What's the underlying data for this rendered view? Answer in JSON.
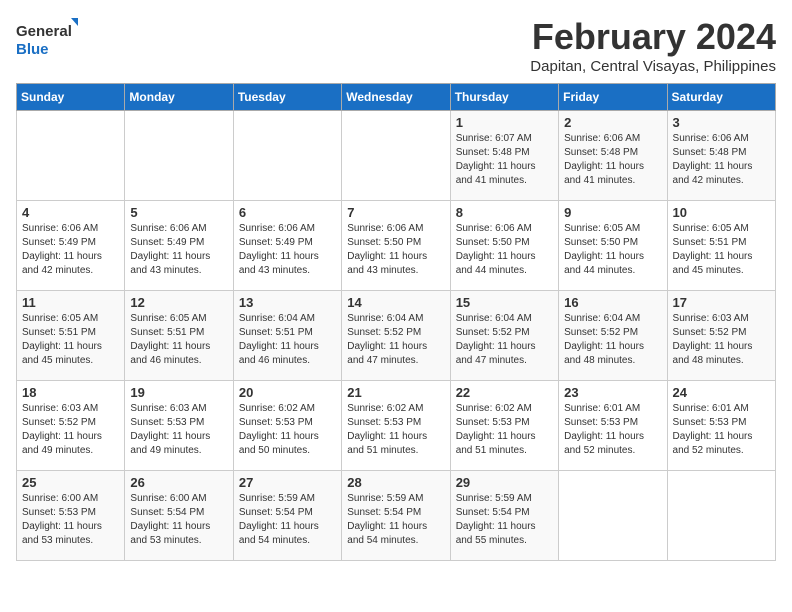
{
  "logo": {
    "line1": "General",
    "line2": "Blue"
  },
  "title": "February 2024",
  "subtitle": "Dapitan, Central Visayas, Philippines",
  "weekdays": [
    "Sunday",
    "Monday",
    "Tuesday",
    "Wednesday",
    "Thursday",
    "Friday",
    "Saturday"
  ],
  "weeks": [
    [
      {
        "day": "",
        "info": ""
      },
      {
        "day": "",
        "info": ""
      },
      {
        "day": "",
        "info": ""
      },
      {
        "day": "",
        "info": ""
      },
      {
        "day": "1",
        "info": "Sunrise: 6:07 AM\nSunset: 5:48 PM\nDaylight: 11 hours\nand 41 minutes."
      },
      {
        "day": "2",
        "info": "Sunrise: 6:06 AM\nSunset: 5:48 PM\nDaylight: 11 hours\nand 41 minutes."
      },
      {
        "day": "3",
        "info": "Sunrise: 6:06 AM\nSunset: 5:48 PM\nDaylight: 11 hours\nand 42 minutes."
      }
    ],
    [
      {
        "day": "4",
        "info": "Sunrise: 6:06 AM\nSunset: 5:49 PM\nDaylight: 11 hours\nand 42 minutes."
      },
      {
        "day": "5",
        "info": "Sunrise: 6:06 AM\nSunset: 5:49 PM\nDaylight: 11 hours\nand 43 minutes."
      },
      {
        "day": "6",
        "info": "Sunrise: 6:06 AM\nSunset: 5:49 PM\nDaylight: 11 hours\nand 43 minutes."
      },
      {
        "day": "7",
        "info": "Sunrise: 6:06 AM\nSunset: 5:50 PM\nDaylight: 11 hours\nand 43 minutes."
      },
      {
        "day": "8",
        "info": "Sunrise: 6:06 AM\nSunset: 5:50 PM\nDaylight: 11 hours\nand 44 minutes."
      },
      {
        "day": "9",
        "info": "Sunrise: 6:05 AM\nSunset: 5:50 PM\nDaylight: 11 hours\nand 44 minutes."
      },
      {
        "day": "10",
        "info": "Sunrise: 6:05 AM\nSunset: 5:51 PM\nDaylight: 11 hours\nand 45 minutes."
      }
    ],
    [
      {
        "day": "11",
        "info": "Sunrise: 6:05 AM\nSunset: 5:51 PM\nDaylight: 11 hours\nand 45 minutes."
      },
      {
        "day": "12",
        "info": "Sunrise: 6:05 AM\nSunset: 5:51 PM\nDaylight: 11 hours\nand 46 minutes."
      },
      {
        "day": "13",
        "info": "Sunrise: 6:04 AM\nSunset: 5:51 PM\nDaylight: 11 hours\nand 46 minutes."
      },
      {
        "day": "14",
        "info": "Sunrise: 6:04 AM\nSunset: 5:52 PM\nDaylight: 11 hours\nand 47 minutes."
      },
      {
        "day": "15",
        "info": "Sunrise: 6:04 AM\nSunset: 5:52 PM\nDaylight: 11 hours\nand 47 minutes."
      },
      {
        "day": "16",
        "info": "Sunrise: 6:04 AM\nSunset: 5:52 PM\nDaylight: 11 hours\nand 48 minutes."
      },
      {
        "day": "17",
        "info": "Sunrise: 6:03 AM\nSunset: 5:52 PM\nDaylight: 11 hours\nand 48 minutes."
      }
    ],
    [
      {
        "day": "18",
        "info": "Sunrise: 6:03 AM\nSunset: 5:52 PM\nDaylight: 11 hours\nand 49 minutes."
      },
      {
        "day": "19",
        "info": "Sunrise: 6:03 AM\nSunset: 5:53 PM\nDaylight: 11 hours\nand 49 minutes."
      },
      {
        "day": "20",
        "info": "Sunrise: 6:02 AM\nSunset: 5:53 PM\nDaylight: 11 hours\nand 50 minutes."
      },
      {
        "day": "21",
        "info": "Sunrise: 6:02 AM\nSunset: 5:53 PM\nDaylight: 11 hours\nand 51 minutes."
      },
      {
        "day": "22",
        "info": "Sunrise: 6:02 AM\nSunset: 5:53 PM\nDaylight: 11 hours\nand 51 minutes."
      },
      {
        "day": "23",
        "info": "Sunrise: 6:01 AM\nSunset: 5:53 PM\nDaylight: 11 hours\nand 52 minutes."
      },
      {
        "day": "24",
        "info": "Sunrise: 6:01 AM\nSunset: 5:53 PM\nDaylight: 11 hours\nand 52 minutes."
      }
    ],
    [
      {
        "day": "25",
        "info": "Sunrise: 6:00 AM\nSunset: 5:53 PM\nDaylight: 11 hours\nand 53 minutes."
      },
      {
        "day": "26",
        "info": "Sunrise: 6:00 AM\nSunset: 5:54 PM\nDaylight: 11 hours\nand 53 minutes."
      },
      {
        "day": "27",
        "info": "Sunrise: 5:59 AM\nSunset: 5:54 PM\nDaylight: 11 hours\nand 54 minutes."
      },
      {
        "day": "28",
        "info": "Sunrise: 5:59 AM\nSunset: 5:54 PM\nDaylight: 11 hours\nand 54 minutes."
      },
      {
        "day": "29",
        "info": "Sunrise: 5:59 AM\nSunset: 5:54 PM\nDaylight: 11 hours\nand 55 minutes."
      },
      {
        "day": "",
        "info": ""
      },
      {
        "day": "",
        "info": ""
      }
    ]
  ]
}
